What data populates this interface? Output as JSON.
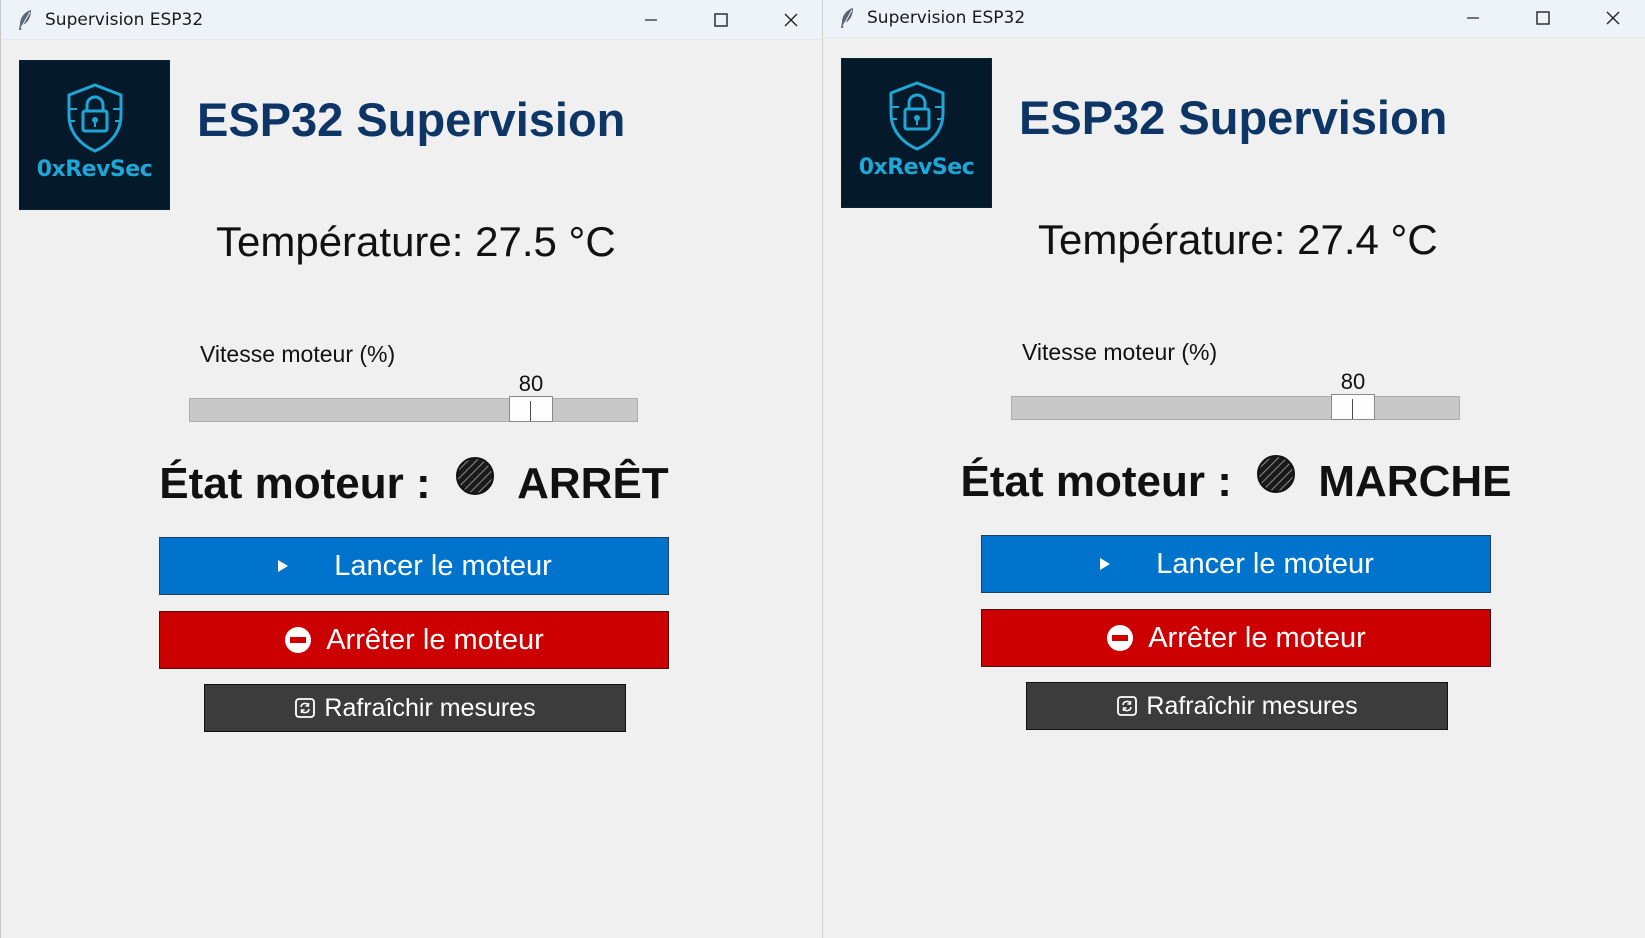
{
  "windows": [
    {
      "title": "Supervision ESP32",
      "logo_text": "0xRevSec",
      "app_title": "ESP32 Supervision",
      "temperature_text": "Température: 27.5 °C",
      "slider": {
        "label": "Vitesse moteur (%)",
        "value": 80,
        "min": 0,
        "max": 100,
        "value_text": "80"
      },
      "state": {
        "label": "État moteur :",
        "value": "ARRÊT"
      },
      "buttons": {
        "start": "Lancer le moteur",
        "stop": "Arrêter le moteur",
        "refresh": "Rafraîchir mesures"
      }
    },
    {
      "title": "Supervision ESP32",
      "logo_text": "0xRevSec",
      "app_title": "ESP32 Supervision",
      "temperature_text": "Température: 27.4 °C",
      "slider": {
        "label": "Vitesse moteur (%)",
        "value": 80,
        "min": 0,
        "max": 100,
        "value_text": "80"
      },
      "state": {
        "label": "État moteur :",
        "value": "MARCHE"
      },
      "buttons": {
        "start": "Lancer le moteur",
        "stop": "Arrêter le moteur",
        "refresh": "Rafraîchir mesures"
      }
    }
  ],
  "icons": {
    "app": "feather-icon",
    "minimize": "minimize-icon",
    "maximize": "maximize-icon",
    "close": "close-icon",
    "logo": "shield-lock-icon",
    "state": "hatched-circle-icon",
    "start": "play-icon",
    "stop": "no-entry-icon",
    "refresh": "refresh-icon"
  },
  "colors": {
    "title": "#0d3566",
    "start_button": "#0074cc",
    "stop_button": "#cc0000",
    "refresh_button": "#3c3c3c",
    "logo_background": "#041a2b",
    "logo_accent": "#1ea7d6"
  }
}
